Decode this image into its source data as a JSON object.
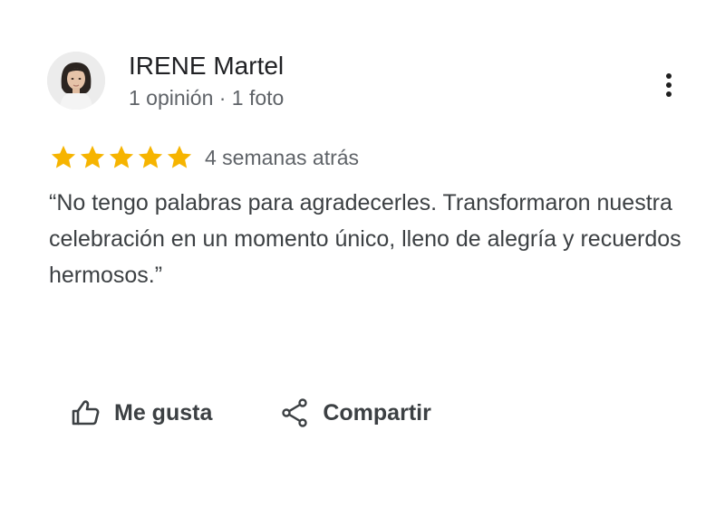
{
  "review": {
    "author": {
      "name": "IRENE Martel",
      "meta": "1 opinión · 1 foto",
      "avatar_icon": "user-photo-avatar"
    },
    "rating": 5,
    "rating_max": 5,
    "date": "4 semanas atrás",
    "text": "“No tengo palabras para agradecerles. Transformaron nuestra celebración en un momento único, lleno de alegría y recuerdos hermosos.”",
    "actions": {
      "like_label": "Me gusta",
      "share_label": "Compartir",
      "like_icon": "thumbs-up-icon",
      "share_icon": "share-icon",
      "more_icon": "more-vert-icon"
    }
  },
  "colors": {
    "star": "#f6b400",
    "name_text": "#202124",
    "meta_text": "#5f6368",
    "body_text": "#3c4043",
    "background": "#ffffff"
  }
}
